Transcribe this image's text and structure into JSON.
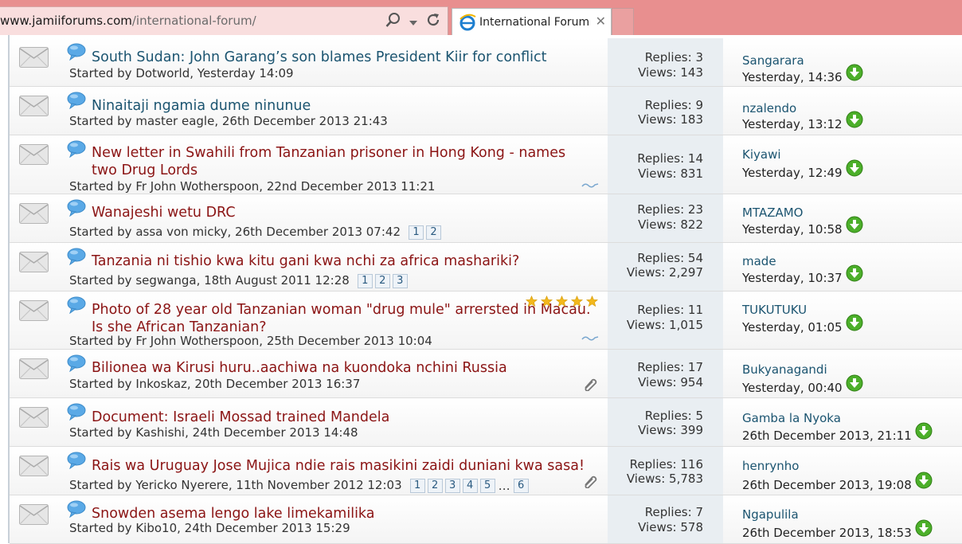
{
  "browser": {
    "url_host": "www.jamiiforums.com",
    "url_path": "/international-forum/",
    "tab_title": "International Forum",
    "tab_close": "✕"
  },
  "threads": [
    {
      "title": "South Sudan: John Garang’s son blames President Kiir for conflict",
      "title_color": "blue",
      "starter": "Started by Dotworld, Yesterday 14:09",
      "replies": "Replies: 3",
      "views": "Views: 143",
      "last_user": "Sangarara",
      "last_date": "Yesterday, 14:36",
      "pages": []
    },
    {
      "title": "Ninaitaji ngamia dume ninunue",
      "title_color": "blue",
      "starter": "Started by master eagle, 26th December 2013 21:43",
      "replies": "Replies: 9",
      "views": "Views: 183",
      "last_user": "nzalendo",
      "last_date": "Yesterday, 13:12",
      "pages": []
    },
    {
      "title": "New letter in Swahili from Tanzanian prisoner in Hong Kong - names two Drug Lords",
      "title_color": "red",
      "starter": "Started by Fr John Wotherspoon, 22nd December 2013 11:21",
      "replies": "Replies: 14",
      "views": "Views: 831",
      "last_user": "Kiyawi",
      "last_date": "Yesterday, 12:49",
      "pages": []
    },
    {
      "title": "Wanajeshi wetu DRC",
      "title_color": "red",
      "starter": "Started by assa von micky, 26th December 2013 07:42",
      "replies": "Replies: 23",
      "views": "Views: 822",
      "last_user": "MTAZAMO",
      "last_date": "Yesterday, 10:58",
      "pages": [
        "1",
        "2"
      ]
    },
    {
      "title": "Tanzania ni tishio kwa kitu gani kwa nchi za africa mashariki?",
      "title_color": "red",
      "starter": "Started by segwanga, 18th August 2011 12:28",
      "replies": "Replies: 54",
      "views": "Views: 2,297",
      "last_user": "made",
      "last_date": "Yesterday, 10:37",
      "pages": [
        "1",
        "2",
        "3"
      ]
    },
    {
      "title": "Photo of 28 year old Tanzanian woman \"drug mule\" arrersted in Macau. Is she African Tanzanian?",
      "title_color": "red",
      "starter": "Started by Fr John Wotherspoon, 25th December 2013 10:04",
      "replies": "Replies: 11",
      "views": "Views: 1,015",
      "last_user": "TUKUTUKU",
      "last_date": "Yesterday, 01:05",
      "pages": [],
      "rating": 5
    },
    {
      "title": "Bilionea wa Kirusi huru..aachiwa na kuondoka nchini Russia",
      "title_color": "red",
      "starter": "Started by Inkoskaz, 20th December 2013 16:37",
      "replies": "Replies: 17",
      "views": "Views: 954",
      "last_user": "Bukyanagandi",
      "last_date": "Yesterday, 00:40",
      "pages": []
    },
    {
      "title": "Document: Israeli Mossad trained Mandela",
      "title_color": "red",
      "starter": "Started by Kashishi, 24th December 2013 14:48",
      "replies": "Replies: 5",
      "views": "Views: 399",
      "last_user": "Gamba la Nyoka",
      "last_date": "26th December 2013, 21:11",
      "pages": []
    },
    {
      "title": "Rais wa Uruguay Jose Mujica ndie rais masikini zaidi duniani kwa sasa!",
      "title_color": "red",
      "starter": "Started by Yericko Nyerere, 11th November 2012 12:03",
      "replies": "Replies: 116",
      "views": "Views: 5,783",
      "last_user": "henrynho",
      "last_date": "26th December 2013, 19:08",
      "pages": [
        "1",
        "2",
        "3",
        "4",
        "5",
        "…",
        "6"
      ]
    },
    {
      "title": "Snowden asema lengo lake limekamilika",
      "title_color": "red",
      "starter": "Started by Kibo10, 24th December 2013 15:29",
      "replies": "Replies: 7",
      "views": "Views: 578",
      "last_user": "Ngapulila",
      "last_date": "26th December 2013, 18:53",
      "pages": []
    }
  ]
}
